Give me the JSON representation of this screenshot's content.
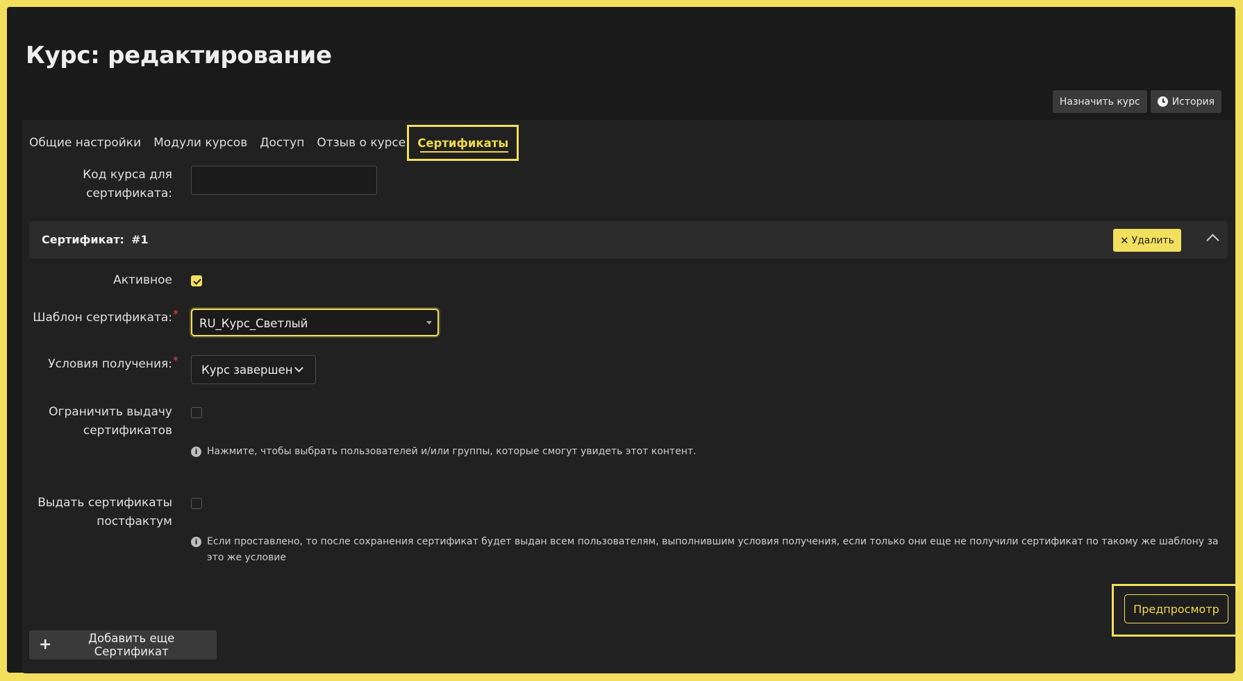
{
  "page": {
    "title": "Курс: редактирование"
  },
  "actions": {
    "assign_label": "Назначить курс",
    "history_label": "История"
  },
  "tabs": [
    {
      "label": "Общие настройки"
    },
    {
      "label": "Модули курсов"
    },
    {
      "label": "Доступ"
    },
    {
      "label": "Отзыв о курсе"
    },
    {
      "label": "Сертификаты",
      "active": true
    }
  ],
  "form": {
    "course_code_label": "Код курса для сертификата:",
    "course_code_value": ""
  },
  "certificate": {
    "title": "Сертификат:",
    "number": "#1",
    "delete_label": "Удалить",
    "active_label": "Активное",
    "active_checked": true,
    "template_label": "Шаблон сертификата:",
    "template_value": "RU_Курс_Светлый",
    "conditions_label": "Условия получения:",
    "conditions_value": "Курс завершен",
    "restrict_label": "Ограничить выдачу сертификатов",
    "restrict_checked": false,
    "restrict_hint": "Нажмите, чтобы выбрать пользователей и/или группы, которые смогут увидеть этот контент.",
    "postfactum_label": "Выдать сертификаты постфактум",
    "postfactum_checked": false,
    "postfactum_hint": "Если проставлено, то после сохранения сертификат будет выдан всем пользователям, выполнившим условия получения, если только они еще не получили сертификат по такому же шаблону за это же условие",
    "preview_label": "Предпросмотр"
  },
  "add_certificate_label": "Добавить еще Сертификат",
  "required_mark": "*",
  "info_icon_glyph": "i",
  "colors": {
    "accent": "#f2df5e",
    "background": "#1a1a1a",
    "panel": "#212121",
    "required": "#e14444"
  }
}
